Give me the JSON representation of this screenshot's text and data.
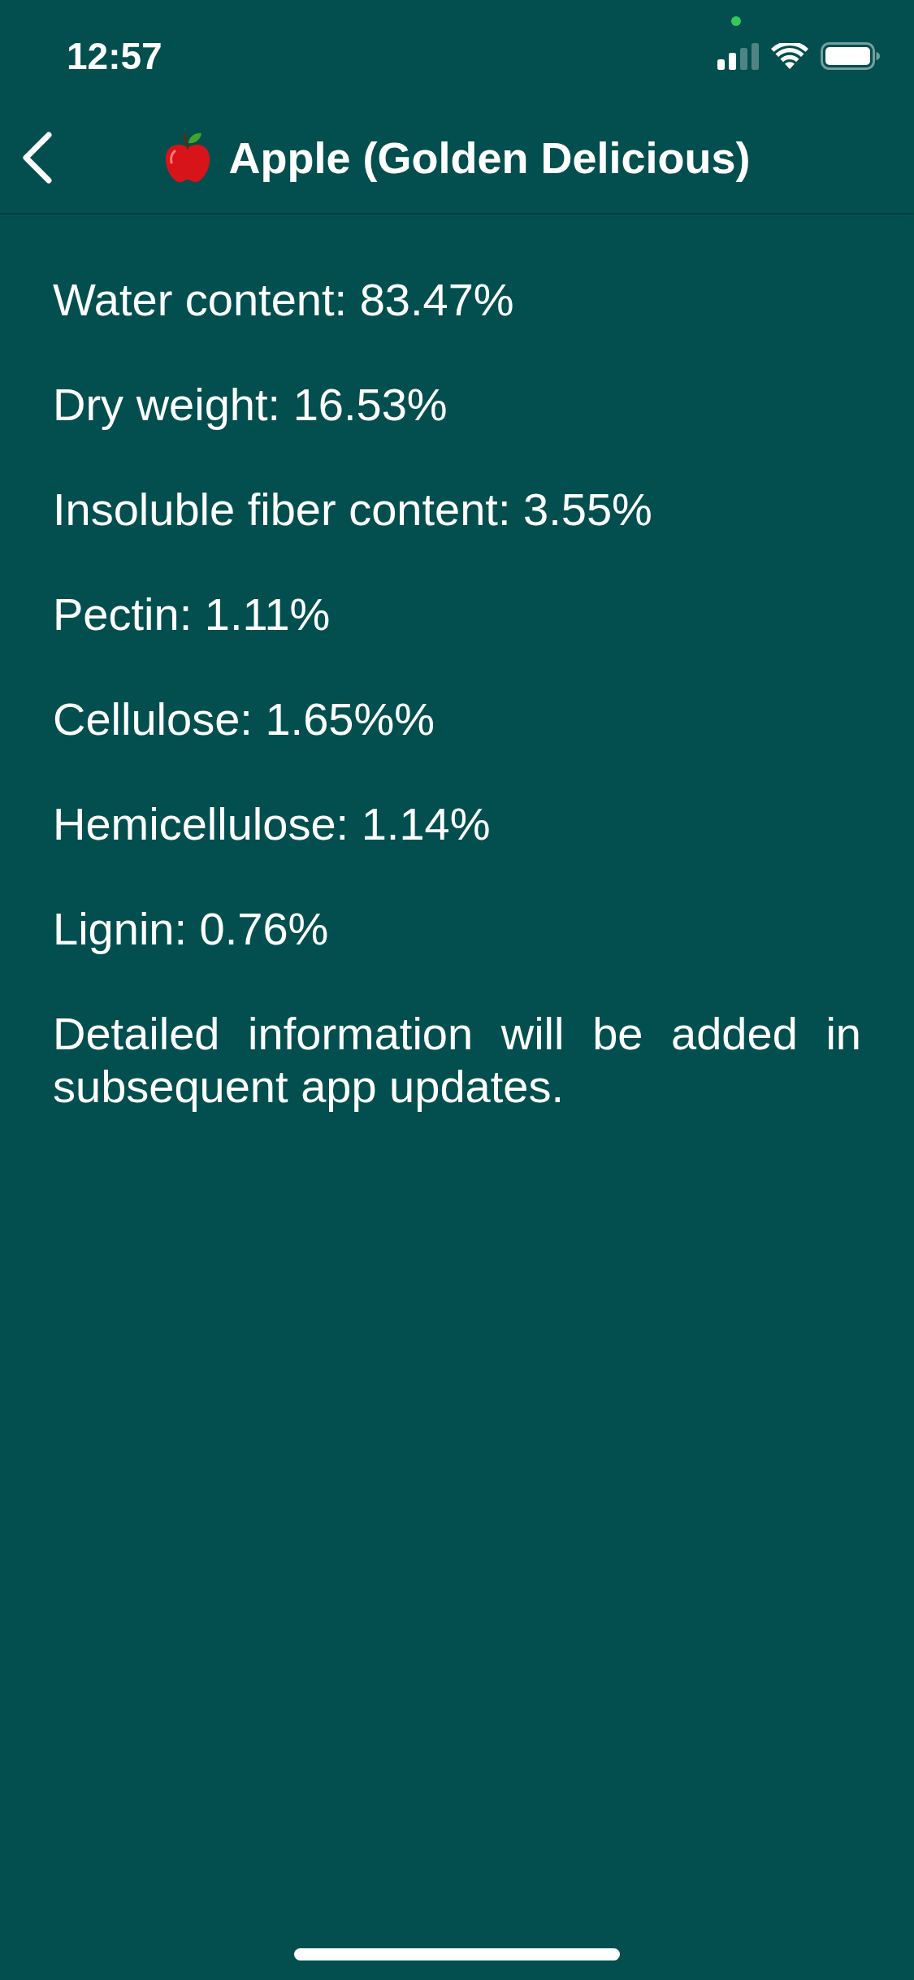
{
  "status_bar": {
    "time": "12:57"
  },
  "nav_bar": {
    "title": "Apple (Golden Delicious)"
  },
  "facts": [
    "Water content: 83.47%",
    "Dry weight: 16.53%",
    "Insoluble fiber content: 3.55%",
    "Pectin: 1.11%",
    "Cellulose: 1.65%%",
    "Hemicellulose: 1.14%",
    "Lignin: 0.76%"
  ],
  "note": "Detailed information will be added in subsequent app updates."
}
